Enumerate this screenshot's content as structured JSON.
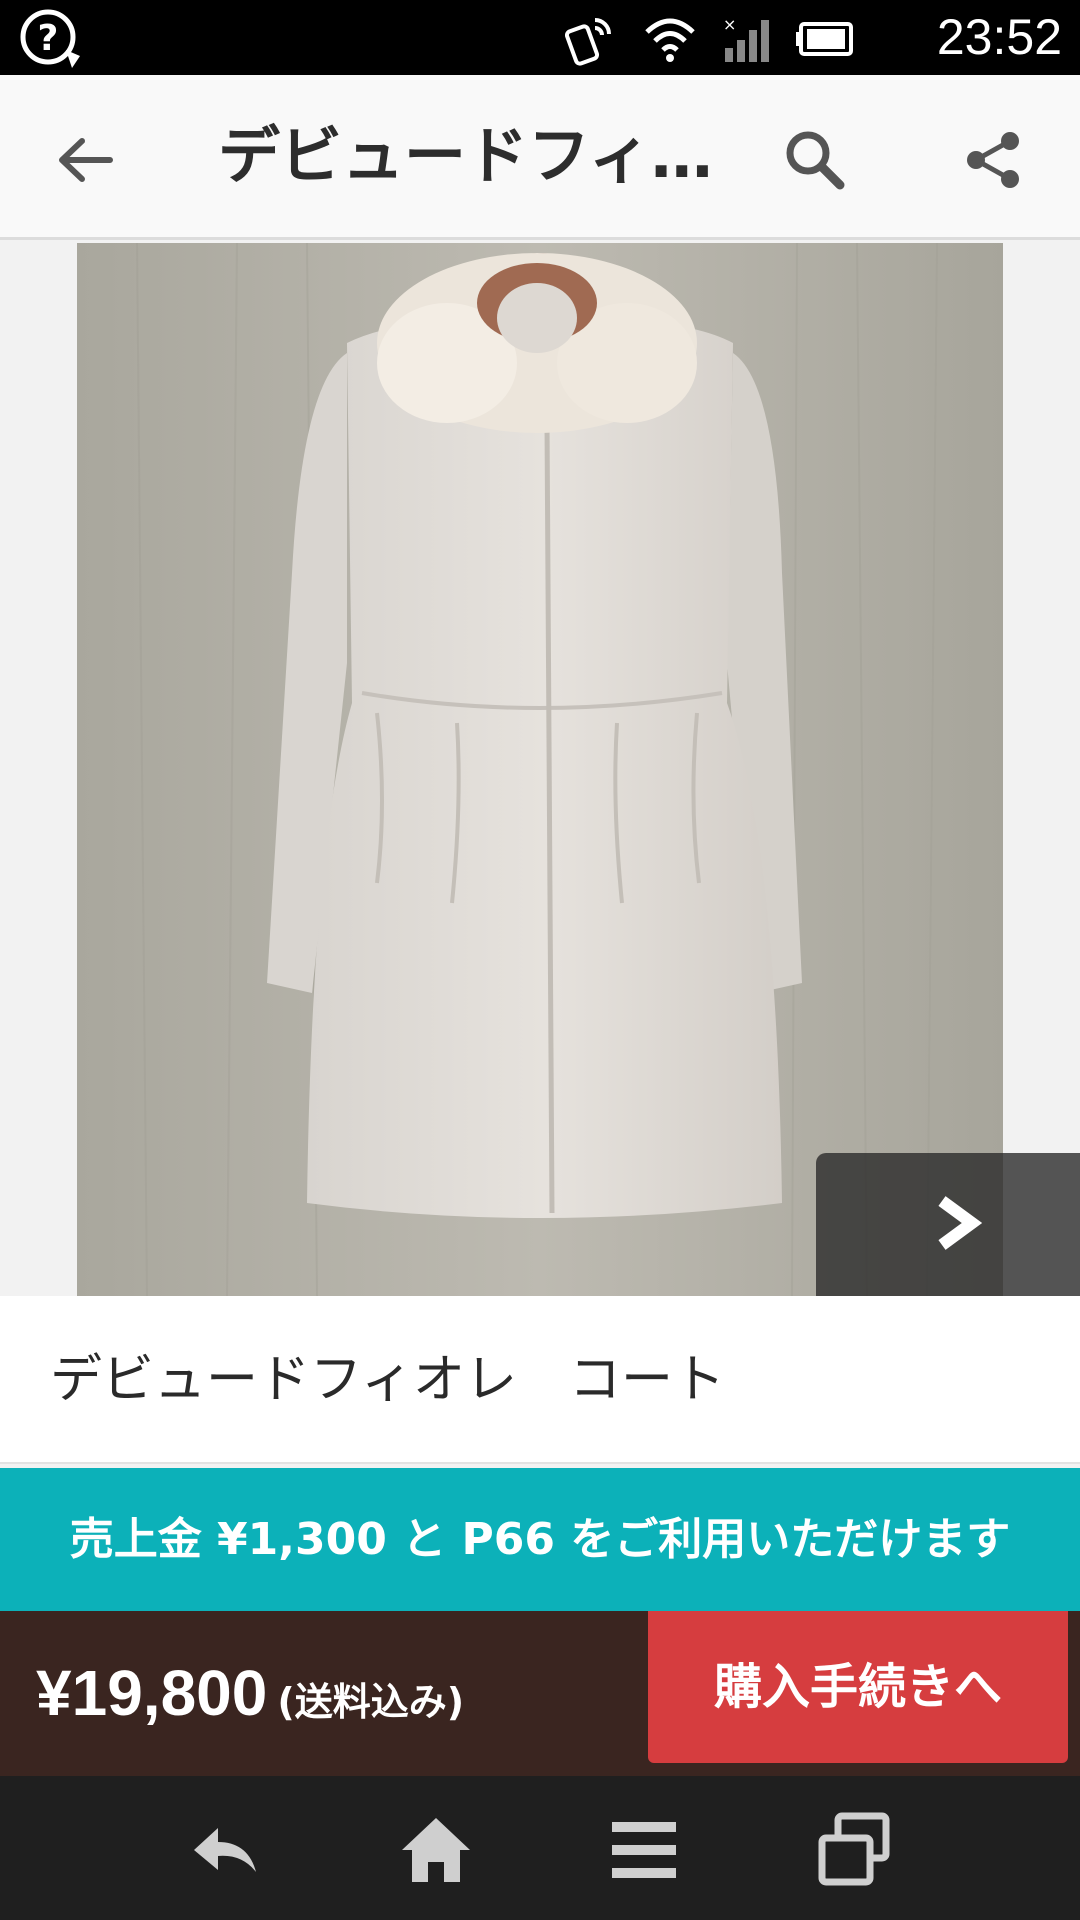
{
  "status_bar": {
    "time": "23:52",
    "icons": [
      "help-circle-icon",
      "nfc-icon",
      "wifi-icon",
      "cellular-signal-icon",
      "battery-icon"
    ]
  },
  "app_bar": {
    "title": "デビュードフィ…",
    "back_icon": "arrow-left-icon",
    "search_icon": "search-icon",
    "share_icon": "share-icon"
  },
  "product": {
    "image_alt": "coat-photo",
    "title": "デビュードフィオレ　コート"
  },
  "banner": {
    "text": "売上金 ¥1,300 と P66 をご利用いただけます"
  },
  "purchase": {
    "price": "¥19,800",
    "shipping_note": "(送料込み)",
    "buy_label": "購入手続きへ"
  },
  "colors": {
    "teal": "#0cb1b9",
    "dark_brown": "#3a2520",
    "red": "#d63d3f"
  },
  "nav_bar": {
    "icons": [
      "back-icon",
      "home-icon",
      "menu-icon",
      "recent-apps-icon"
    ]
  }
}
